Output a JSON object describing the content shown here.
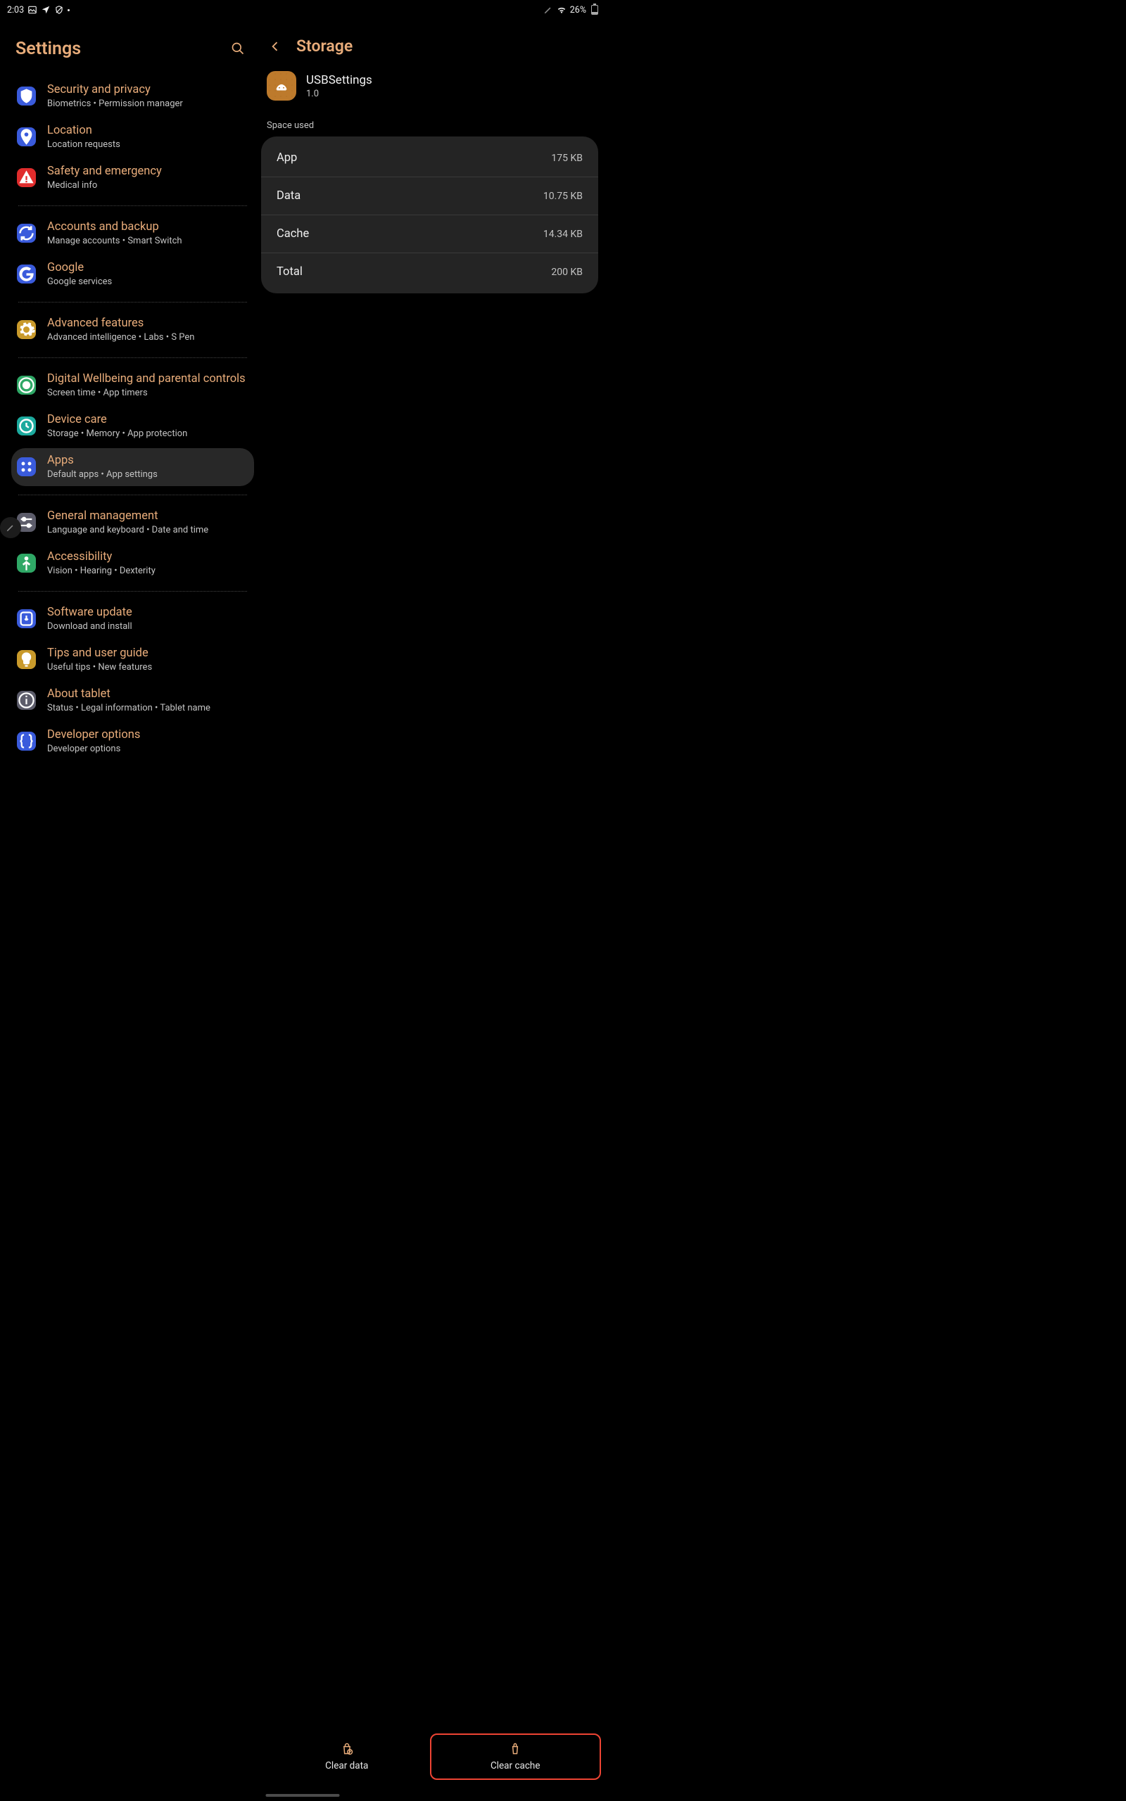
{
  "status": {
    "time": "2:03",
    "battery_pct": "26%"
  },
  "left": {
    "title": "Settings",
    "items": [
      {
        "title": "Security and privacy",
        "sub": "Biometrics  •  Permission manager",
        "icon": "shield-icon",
        "bg": "bg-blue"
      },
      {
        "title": "Location",
        "sub": "Location requests",
        "icon": "pin-icon",
        "bg": "bg-blue"
      },
      {
        "title": "Safety and emergency",
        "sub": "Medical info",
        "icon": "alert-icon",
        "bg": "bg-red"
      },
      {
        "title": "Accounts and backup",
        "sub": "Manage accounts  •  Smart Switch",
        "icon": "sync-icon",
        "bg": "bg-blue"
      },
      {
        "title": "Google",
        "sub": "Google services",
        "icon": "google-icon",
        "bg": "bg-blue"
      },
      {
        "title": "Advanced features",
        "sub": "Advanced intelligence  •  Labs  •  S Pen",
        "icon": "gear-icon",
        "bg": "bg-amber"
      },
      {
        "title": "Digital Wellbeing and parental controls",
        "sub": "Screen time  •  App timers",
        "icon": "wellbeing-icon",
        "bg": "bg-green"
      },
      {
        "title": "Device care",
        "sub": "Storage  •  Memory  •  App protection",
        "icon": "care-icon",
        "bg": "bg-teal"
      },
      {
        "title": "Apps",
        "sub": "Default apps  •  App settings",
        "icon": "apps-icon",
        "bg": "bg-blue",
        "selected": true
      },
      {
        "title": "General management",
        "sub": "Language and keyboard  •  Date and time",
        "icon": "sliders-icon",
        "bg": "bg-grey"
      },
      {
        "title": "Accessibility",
        "sub": "Vision  •  Hearing  •  Dexterity",
        "icon": "person-icon",
        "bg": "bg-green"
      },
      {
        "title": "Software update",
        "sub": "Download and install",
        "icon": "update-icon",
        "bg": "bg-blue"
      },
      {
        "title": "Tips and user guide",
        "sub": "Useful tips  •  New features",
        "icon": "bulb-icon",
        "bg": "bg-amber"
      },
      {
        "title": "About tablet",
        "sub": "Status  •  Legal information  •  Tablet name",
        "icon": "info-icon",
        "bg": "bg-grey"
      },
      {
        "title": "Developer options",
        "sub": "Developer options",
        "icon": "braces-icon",
        "bg": "bg-blue"
      }
    ],
    "dividers_after": [
      2,
      4,
      5,
      8,
      10
    ]
  },
  "right": {
    "title": "Storage",
    "app": {
      "name": "USBSettings",
      "version": "1.0"
    },
    "section": "Space used",
    "rows": [
      {
        "k": "App",
        "v": "175 KB"
      },
      {
        "k": "Data",
        "v": "10.75 KB"
      },
      {
        "k": "Cache",
        "v": "14.34 KB"
      },
      {
        "k": "Total",
        "v": "200 KB"
      }
    ],
    "actions": {
      "clear_data": "Clear data",
      "clear_cache": "Clear cache"
    }
  }
}
